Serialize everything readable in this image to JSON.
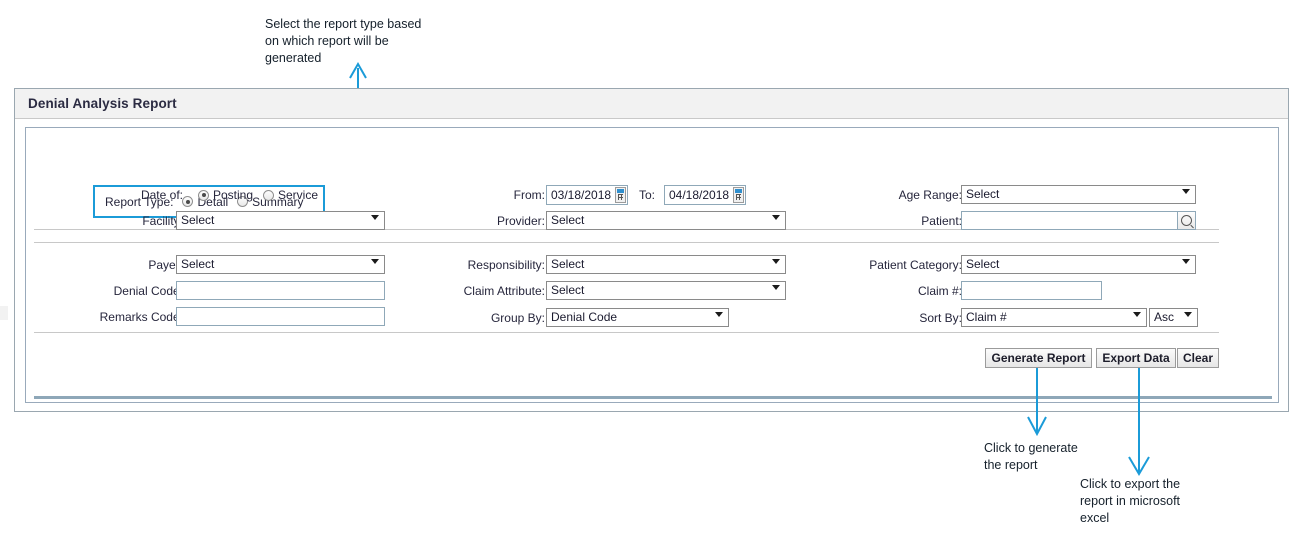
{
  "panel": {
    "title": "Denial Analysis Report"
  },
  "report_type": {
    "label": "Report Type:",
    "options": [
      {
        "label": "Detail",
        "selected": true
      },
      {
        "label": "Summary",
        "selected": false
      }
    ]
  },
  "section1": {
    "date_of": {
      "label": "Date of:",
      "options": [
        {
          "label": "Posting",
          "selected": true
        },
        {
          "label": "Service",
          "selected": false
        }
      ]
    },
    "facility": {
      "label": "Facility:",
      "value": "Select"
    },
    "from": {
      "label": "From:",
      "value": "03/18/2018",
      "icon": "calendar-icon"
    },
    "to": {
      "label": "To:",
      "value": "04/18/2018",
      "icon": "calendar-icon"
    },
    "provider": {
      "label": "Provider:",
      "value": "Select"
    },
    "age_range": {
      "label": "Age Range:",
      "value": "Select"
    },
    "patient": {
      "label": "Patient:",
      "value": "",
      "placeholder": "",
      "icon": "search-icon"
    }
  },
  "section2": {
    "payer": {
      "label": "Payer:",
      "value": "Select"
    },
    "denial_code": {
      "label": "Denial Code:",
      "value": "",
      "placeholder": ""
    },
    "remarks_code": {
      "label": "Remarks Code:",
      "value": "",
      "placeholder": ""
    },
    "responsibility": {
      "label": "Responsibility:",
      "value": "Select"
    },
    "claim_attribute": {
      "label": "Claim Attribute:",
      "value": "Select"
    },
    "group_by": {
      "label": "Group By:",
      "value": "Denial Code"
    },
    "patient_category": {
      "label": "Patient Category:",
      "value": "Select"
    },
    "claim_number": {
      "label": "Claim #:",
      "value": "",
      "placeholder": ""
    },
    "sort_by": {
      "label": "Sort By:",
      "value": "Claim #",
      "direction": "Asc"
    }
  },
  "buttons": {
    "generate": "Generate Report",
    "export": "Export Data",
    "clear": "Clear"
  },
  "annotations": {
    "report_type_note": "Select the report type based\non which report will be\ngenerated",
    "generate_note": "Click to generate\nthe report",
    "export_note": "Click to export the\nreport in microsoft\nexcel",
    "color": "#1b9bd8"
  }
}
